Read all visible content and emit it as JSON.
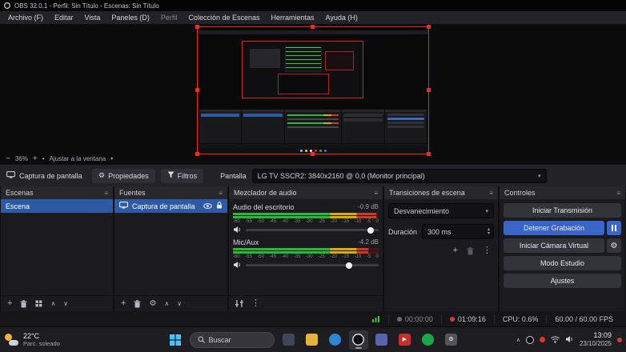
{
  "window": {
    "title": "OBS 32.0.1 - Perfil: Sin Título - Escenas: Sin Título"
  },
  "menubar": {
    "items": [
      {
        "id": "archivo",
        "label": "Archivo (F)",
        "dim": false
      },
      {
        "id": "editar",
        "label": "Editar",
        "dim": false
      },
      {
        "id": "vista",
        "label": "Vista",
        "dim": false
      },
      {
        "id": "paneles",
        "label": "Paneles (D)",
        "dim": false
      },
      {
        "id": "perfil",
        "label": "Perfil",
        "dim": true
      },
      {
        "id": "coleccion-de-escenas",
        "label": "Colección de Escenas",
        "dim": false
      },
      {
        "id": "herramientas",
        "label": "Herramientas",
        "dim": false
      },
      {
        "id": "ayuda",
        "label": "Ayuda (H)",
        "dim": false
      }
    ]
  },
  "preview": {
    "zoom_level": "36%",
    "fit_label": "Ajustar a la ventana"
  },
  "source_toolbar": {
    "source_name": "Captura de pantalla",
    "properties_label": "Propiedades",
    "filters_label": "Filtros",
    "display_label": "Pantalla",
    "display_value": "LG TV SSCR2: 3840x2160 @ 0,0 (Monitor principal)"
  },
  "scenes": {
    "title": "Escenas",
    "items": [
      {
        "name": "Escena",
        "selected": true
      }
    ]
  },
  "sources": {
    "title": "Fuentes",
    "items": [
      {
        "name": "Captura de pantalla",
        "selected": true
      }
    ]
  },
  "mixer": {
    "title": "Mezclador de audio",
    "scale_ticks": [
      "-60",
      "-55",
      "-50",
      "-45",
      "-40",
      "-35",
      "-30",
      "-25",
      "-20",
      "-15",
      "-10",
      "-5",
      "0"
    ],
    "channels": [
      {
        "name": "Audio del escritorio",
        "level_label": "-0.9 dB",
        "level_db": -0.9,
        "volume_slider_pct": 94
      },
      {
        "name": "Mic/Aux",
        "level_label": "-4.2 dB",
        "level_db": -4.2,
        "volume_slider_pct": 78
      }
    ]
  },
  "transitions": {
    "title": "Transiciones de escena",
    "selected_transition": "Desvanecimiento",
    "duration_label": "Duración",
    "duration_value": "300 ms"
  },
  "controls": {
    "title": "Controles",
    "start_streaming": "Iniciar Transmisión",
    "stop_recording": "Detener Grabación",
    "start_virtual_camera": "Iniciar Cámara Virtual",
    "studio_mode": "Modo Estudio",
    "settings": "Ajustes"
  },
  "statusbar": {
    "stream_timer": "00:00:00",
    "recording_timer": "01:09:16",
    "cpu": "CPU: 0.6%",
    "fps": "60.00 / 60.00 FPS"
  },
  "taskbar": {
    "weather_temp": "22°C",
    "weather_desc": "Parc. soleado",
    "search_label": "Buscar",
    "clock_time": "13:09",
    "clock_date": "23/10/2025",
    "app_icons": [
      {
        "name": "task-view",
        "color": "#3f4656",
        "shape": "square"
      },
      {
        "name": "file-explorer",
        "color": "#e8b33d",
        "shape": "square"
      },
      {
        "name": "edge",
        "color": "#2e86d6",
        "shape": "circle"
      },
      {
        "name": "obs-studio",
        "color": "#0e0e10",
        "shape": "circle",
        "ring": true,
        "active": true
      },
      {
        "name": "discord",
        "color": "#5865a8",
        "shape": "square"
      },
      {
        "name": "youtube",
        "color": "#c4302b",
        "shape": "square",
        "glyph": "▶"
      },
      {
        "name": "spotify",
        "color": "#17a84c",
        "shape": "circle"
      },
      {
        "name": "settings",
        "color": "#54545c",
        "shape": "square",
        "glyph": "⚙"
      }
    ]
  },
  "icons": {
    "zoom_out": "−",
    "zoom_in": "+",
    "separator_dot": "•",
    "chevron_down": "▾",
    "chevron_up": "∧",
    "spin_up": "▴",
    "spin_down": "▾",
    "add": "+",
    "move_up": "∧",
    "move_down": "∨",
    "more_vertical": "⋮",
    "gear": "⚙",
    "dock_menu": "≡"
  },
  "colors": {
    "accent_blue": "#3a66c8",
    "selection_blue": "#2e59a3",
    "source_border_red": "#ff1f1f",
    "recording_red": "#e3342a",
    "meter_green": "#2db63c",
    "meter_yellow": "#d4ad07",
    "meter_red": "#c93b29"
  }
}
